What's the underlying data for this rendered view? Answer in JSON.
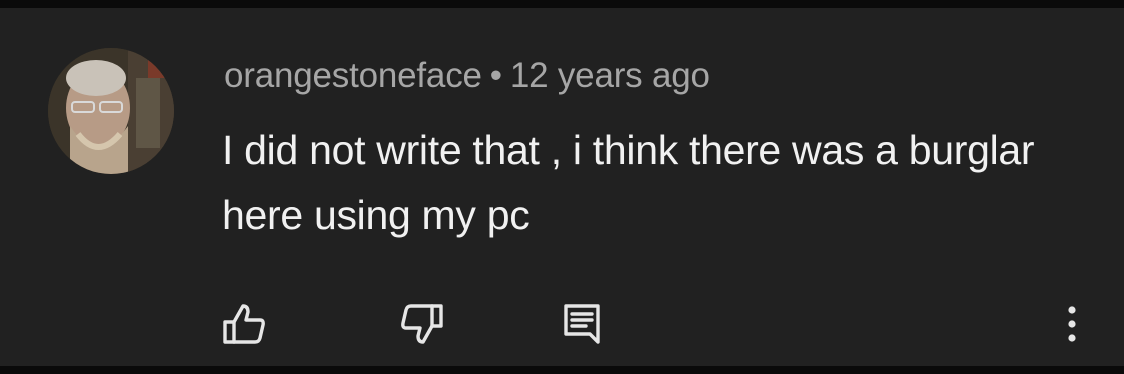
{
  "comment": {
    "author": "orangestoneface",
    "separator": "•",
    "timestamp": "12 years ago",
    "text": "I did not write that , i think there was a burglar here using my pc"
  },
  "icons": {
    "avatar": "user-avatar-photo",
    "like": "thumbs-up-icon",
    "dislike": "thumbs-down-icon",
    "reply": "reply-comment-icon",
    "more": "more-vertical-icon"
  },
  "colors": {
    "background": "#212121",
    "primary_text": "#f1f1f1",
    "secondary_text": "#a6a6a6",
    "icon": "#e6e6e6"
  }
}
